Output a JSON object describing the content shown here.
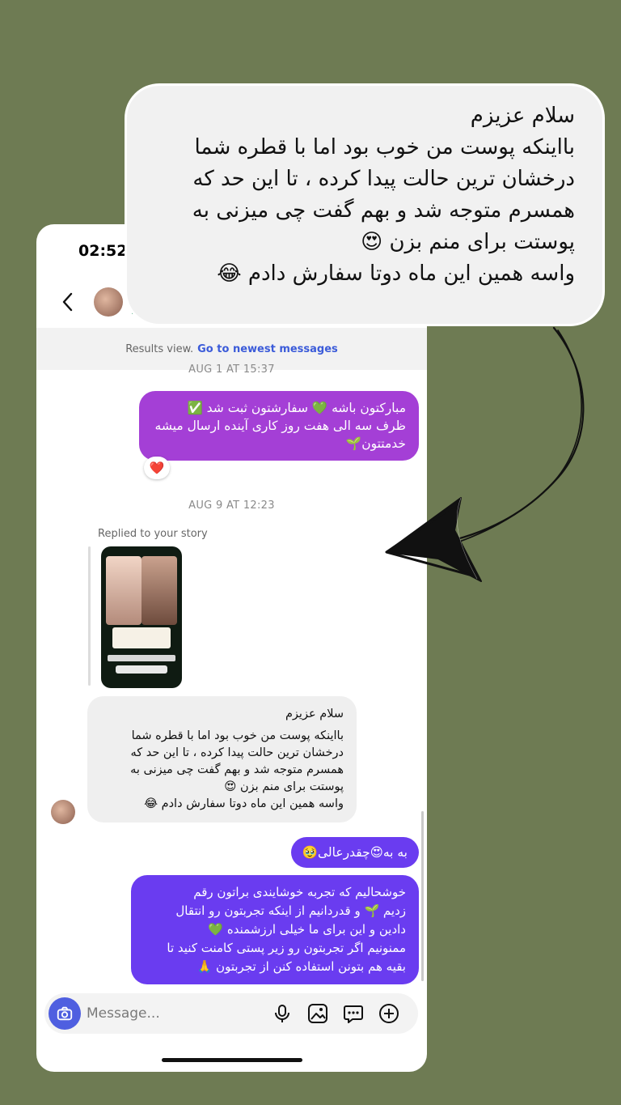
{
  "status_bar": {
    "time": "02:52"
  },
  "header": {
    "name_fragment": "R"
  },
  "results_bar": {
    "label": "Results view.",
    "link": "Go to newest messages"
  },
  "thread": {
    "timestamp_1": "AUG 1 AT 15:37",
    "msg_1": [
      "مبارکتون باشه 💚 سفارشتون ثبت شد ✅",
      "ظرف سه الی هفت روز کاری آینده ارسال میشه",
      "خدمتتون🌱"
    ],
    "reaction_1": "❤️",
    "timestamp_2": "AUG 9 AT 12:23",
    "replied_label": "Replied to your story",
    "msg_2": [
      "سلام عزیزم",
      "بااینکه پوست من خوب بود اما با قطره شما",
      "درخشان ترین حالت پیدا کرده ، تا این حد که",
      "همسرم متوجه شد و بهم گفت چی میزنی به",
      "پوستت برای منم بزن 😍",
      "واسه همین این ماه دوتا سفارش دادم 😂"
    ],
    "msg_3": "به به😍چقدرعالی🥹",
    "msg_4": [
      "خوشحالیم که تجربه خوشایندی براتون رقم",
      "زدیم 🌱 و قدردانیم از اینکه تجربتون رو انتقال",
      "دادین و این برای ما خیلی ارزشمنده 💚",
      "ممنونیم اگر تجربتون رو زیر پستی کامنت کنید تا",
      "بقیه هم بتونن استفاده کنن از تجربتون 🙏"
    ]
  },
  "composer": {
    "placeholder": "Message..."
  },
  "callout": {
    "lines": [
      "سلام عزیزم",
      "بااینکه پوست من خوب بود اما با قطره شما",
      "درخشان ترین حالت پیدا کرده ، تا این حد که",
      "همسرم متوجه شد و بهم گفت چی میزنی به",
      "پوستت برای منم بزن 😍",
      "واسه همین این ماه دوتا سفارش دادم 😂"
    ]
  },
  "colors": {
    "background": "#6e7b53",
    "bubble_purple": "#a43fd6",
    "bubble_violet": "#6a3cf0",
    "accent_blue": "#3b5bd9"
  },
  "icons": [
    "chevron-left-icon",
    "camera-icon",
    "microphone-icon",
    "gallery-icon",
    "sticker-icon",
    "plus-icon",
    "heart-icon"
  ]
}
